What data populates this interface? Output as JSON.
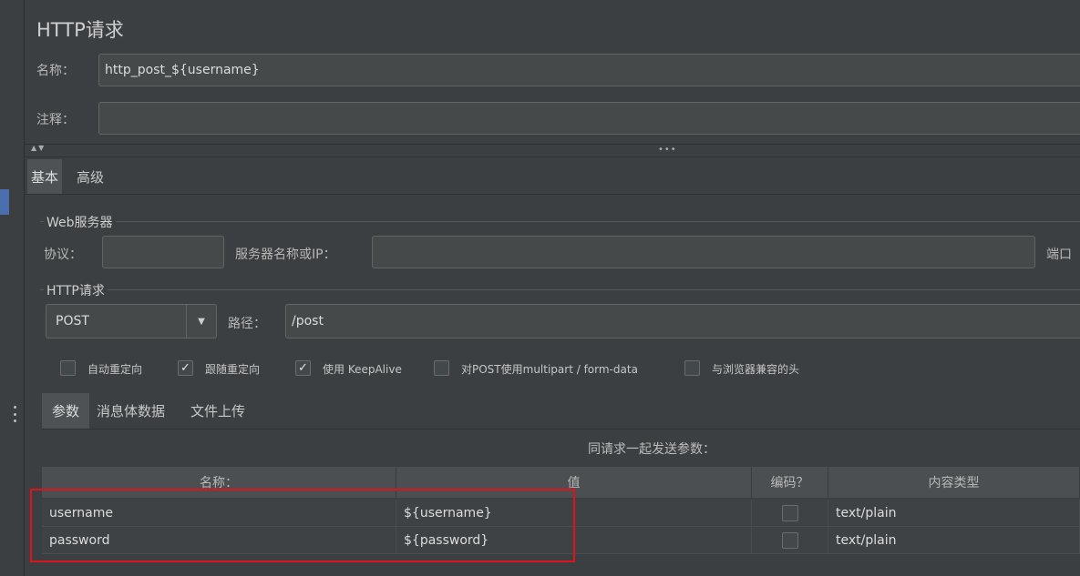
{
  "panel": {
    "title": "HTTP请求"
  },
  "name_field": {
    "label": "名称：",
    "value": "http_post_${username}"
  },
  "comment_field": {
    "label": "注释：",
    "value": ""
  },
  "tabs": [
    {
      "label": "基本",
      "active": true
    },
    {
      "label": "高级",
      "active": false
    }
  ],
  "web_server": {
    "group_title": "Web服务器",
    "protocol_label": "协议：",
    "protocol_value": "",
    "server_label": "服务器名称或IP：",
    "server_value": "",
    "port_label": "端口"
  },
  "http_request": {
    "group_title": "HTTP请求",
    "method": "POST",
    "path_label": "路径：",
    "path_value": "/post"
  },
  "options": [
    {
      "label": "自动重定向",
      "checked": false
    },
    {
      "label": "跟随重定向",
      "checked": true
    },
    {
      "label": "使用 KeepAlive",
      "checked": true
    },
    {
      "label": "对POST使用multipart / form-data",
      "checked": false
    },
    {
      "label": "与浏览器兼容的头",
      "checked": false
    }
  ],
  "sub_tabs": [
    {
      "label": "参数",
      "active": true
    },
    {
      "label": "消息体数据",
      "active": false
    },
    {
      "label": "文件上传",
      "active": false
    }
  ],
  "params_table": {
    "caption": "同请求一起发送参数：",
    "columns": [
      "名称：",
      "值",
      "编码？",
      "内容类型"
    ],
    "rows": [
      {
        "name": "username",
        "value": "${username}",
        "encode": false,
        "content_type": "text/plain"
      },
      {
        "name": "password",
        "value": "${password}",
        "encode": false,
        "content_type": "text/plain"
      }
    ]
  },
  "colors": {
    "background": "#3c3f41",
    "highlight": "#e0131b",
    "accent": "#4b6eaf"
  }
}
